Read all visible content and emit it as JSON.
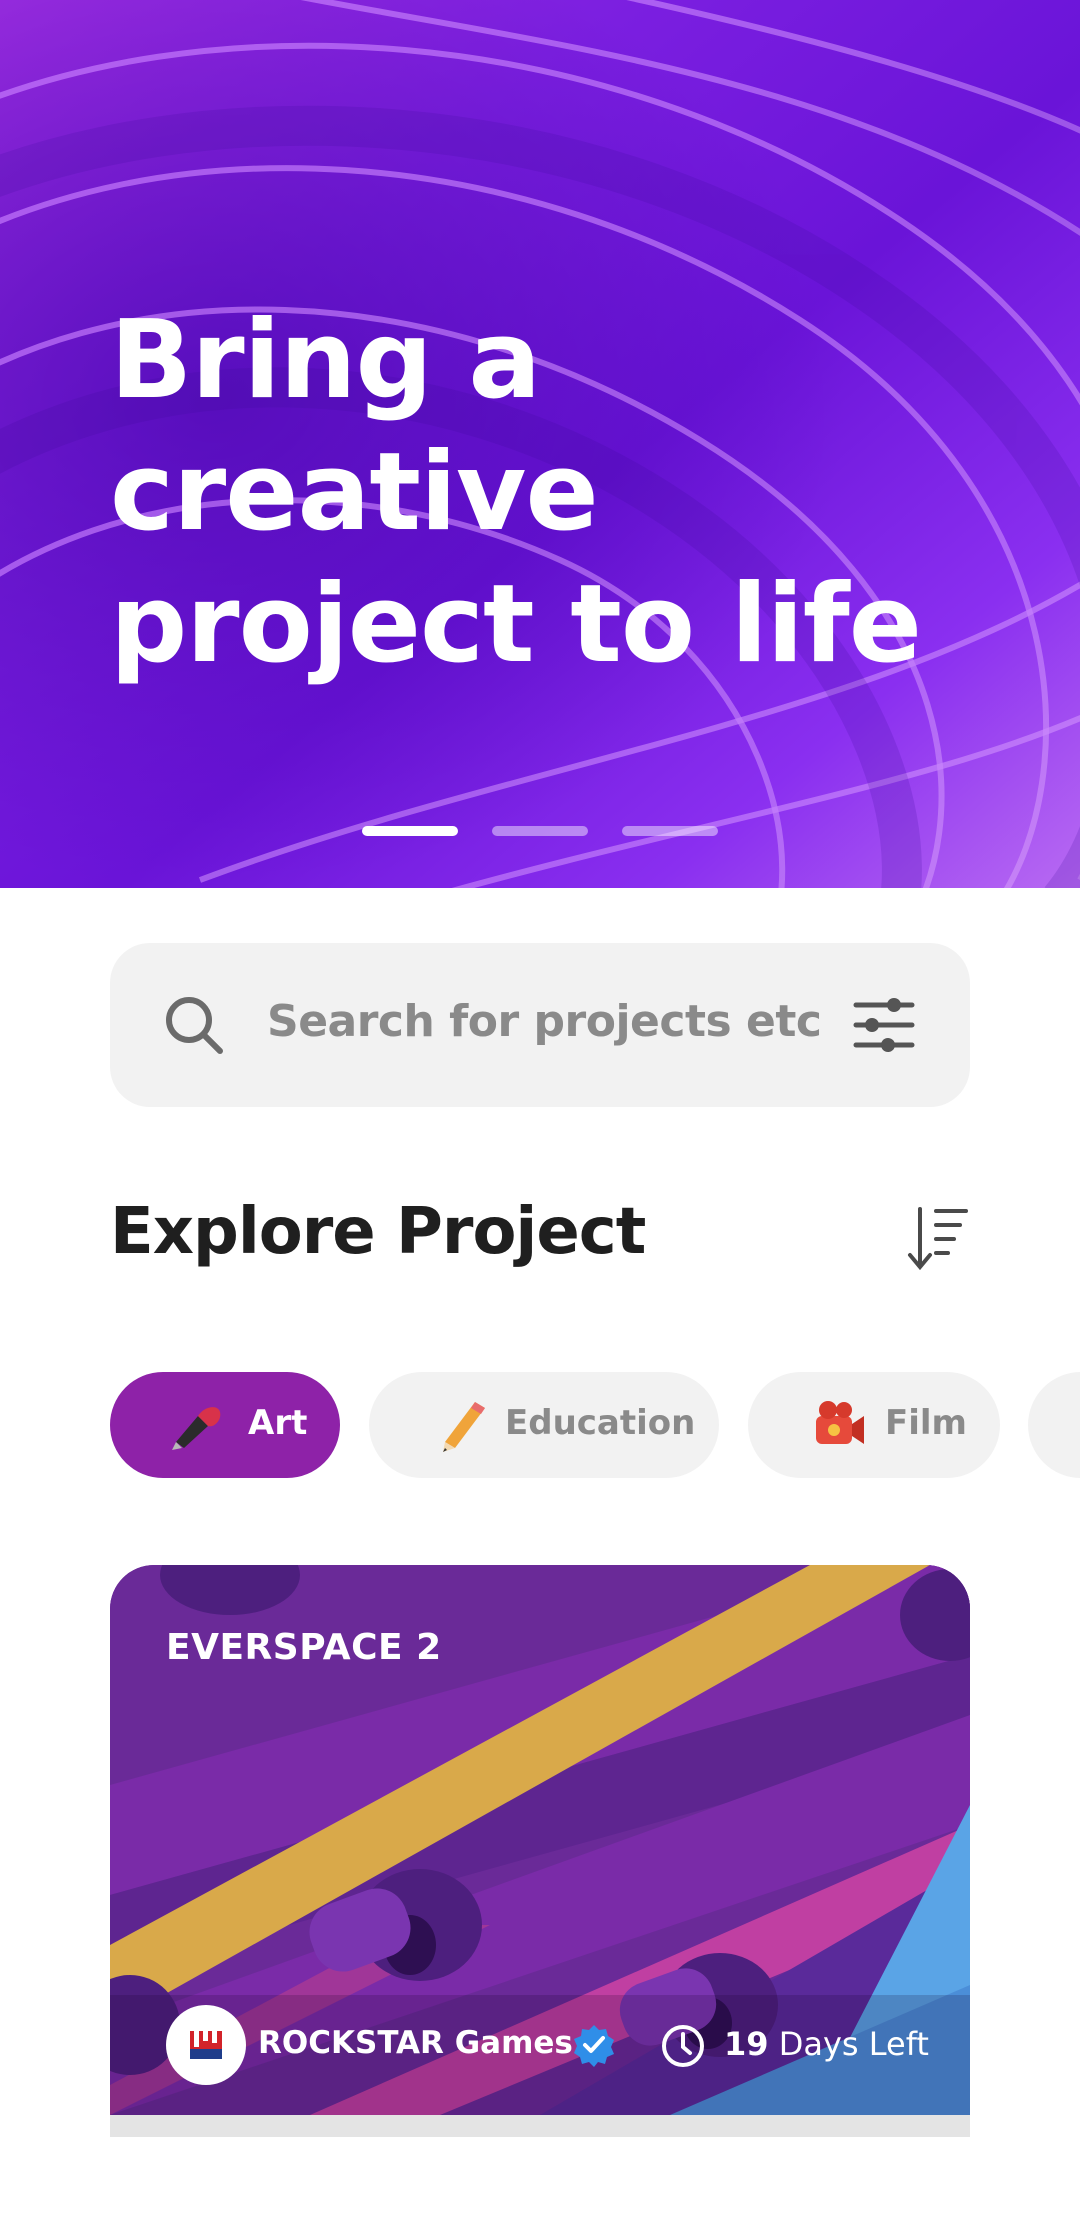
{
  "hero": {
    "title": "Bring a creative project to life",
    "carousel": {
      "pages": 3,
      "active_index": 0
    }
  },
  "search": {
    "placeholder": "Search for projects etc",
    "search_icon": "search-icon",
    "filter_icon": "sliders-icon"
  },
  "explore": {
    "title": "Explore Project",
    "sort_icon": "sort-descending-icon"
  },
  "categories": [
    {
      "label": "Art",
      "icon": "paint-brush-icon",
      "active": true
    },
    {
      "label": "Education",
      "icon": "pencil-icon",
      "active": false
    },
    {
      "label": "Film",
      "icon": "movie-camera-icon",
      "active": false
    }
  ],
  "project_card": {
    "title": "EVERSPACE 2",
    "studio": "ROCKSTAR Games",
    "verified_icon": "verified-badge-icon",
    "days_left_number": "19",
    "days_left_text": " Days Left",
    "clock_icon": "clock-icon"
  },
  "colors": {
    "accent": "#8e22a8",
    "hero_purple": "#7b1fe0",
    "chip_bg": "#f2f2f2",
    "verified_blue": "#2f8ee8"
  }
}
